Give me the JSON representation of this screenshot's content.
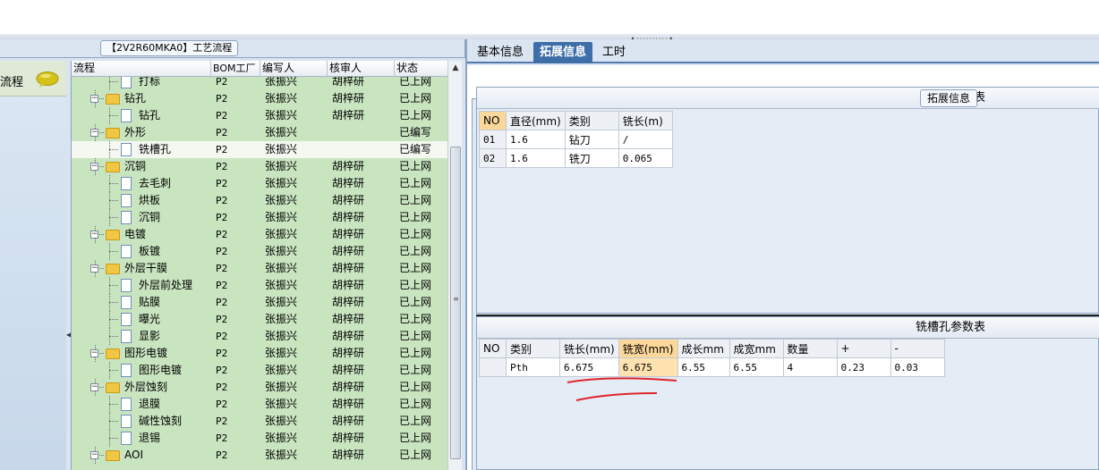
{
  "left_pane": {
    "legend": "【2V2R60MKA0】工艺流程",
    "flow_label": "流程",
    "tree_columns": [
      "流程",
      "BOM工厂",
      "编写人",
      "核审人",
      "状态"
    ],
    "rows": [
      {
        "level": 2,
        "type": "doc",
        "name": "打标",
        "bom": "P2",
        "writer": "张振兴",
        "reviewer": "胡梓研",
        "status": "已上网"
      },
      {
        "level": 1,
        "type": "folder",
        "name": "钻孔",
        "bom": "P2",
        "writer": "张振兴",
        "reviewer": "胡梓研",
        "status": "已上网"
      },
      {
        "level": 2,
        "type": "doc",
        "name": "钻孔",
        "bom": "P2",
        "writer": "张振兴",
        "reviewer": "胡梓研",
        "status": "已上网"
      },
      {
        "level": 1,
        "type": "folder",
        "name": "外形",
        "bom": "P2",
        "writer": "张振兴",
        "reviewer": "",
        "status": "已编写"
      },
      {
        "level": 2,
        "type": "doc",
        "name": "铣槽孔",
        "bom": "P2",
        "writer": "张振兴",
        "reviewer": "",
        "status": "已编写",
        "selected": true
      },
      {
        "level": 1,
        "type": "folder",
        "name": "沉铜",
        "bom": "P2",
        "writer": "张振兴",
        "reviewer": "胡梓研",
        "status": "已上网"
      },
      {
        "level": 2,
        "type": "doc",
        "name": "去毛刺",
        "bom": "P2",
        "writer": "张振兴",
        "reviewer": "胡梓研",
        "status": "已上网"
      },
      {
        "level": 2,
        "type": "doc",
        "name": "烘板",
        "bom": "P2",
        "writer": "张振兴",
        "reviewer": "胡梓研",
        "status": "已上网"
      },
      {
        "level": 2,
        "type": "doc",
        "name": "沉铜",
        "bom": "P2",
        "writer": "张振兴",
        "reviewer": "胡梓研",
        "status": "已上网"
      },
      {
        "level": 1,
        "type": "folder",
        "name": "电镀",
        "bom": "P2",
        "writer": "张振兴",
        "reviewer": "胡梓研",
        "status": "已上网"
      },
      {
        "level": 2,
        "type": "doc",
        "name": "板镀",
        "bom": "P2",
        "writer": "张振兴",
        "reviewer": "胡梓研",
        "status": "已上网"
      },
      {
        "level": 1,
        "type": "folder",
        "name": "外层干膜",
        "bom": "P2",
        "writer": "张振兴",
        "reviewer": "胡梓研",
        "status": "已上网"
      },
      {
        "level": 2,
        "type": "doc",
        "name": "外层前处理",
        "bom": "P2",
        "writer": "张振兴",
        "reviewer": "胡梓研",
        "status": "已上网"
      },
      {
        "level": 2,
        "type": "doc",
        "name": "贴膜",
        "bom": "P2",
        "writer": "张振兴",
        "reviewer": "胡梓研",
        "status": "已上网"
      },
      {
        "level": 2,
        "type": "doc",
        "name": "曝光",
        "bom": "P2",
        "writer": "张振兴",
        "reviewer": "胡梓研",
        "status": "已上网"
      },
      {
        "level": 2,
        "type": "doc",
        "name": "显影",
        "bom": "P2",
        "writer": "张振兴",
        "reviewer": "胡梓研",
        "status": "已上网"
      },
      {
        "level": 1,
        "type": "folder",
        "name": "图形电镀",
        "bom": "P2",
        "writer": "张振兴",
        "reviewer": "胡梓研",
        "status": "已上网"
      },
      {
        "level": 2,
        "type": "doc",
        "name": "图形电镀",
        "bom": "P2",
        "writer": "张振兴",
        "reviewer": "胡梓研",
        "status": "已上网"
      },
      {
        "level": 1,
        "type": "folder",
        "name": "外层蚀刻",
        "bom": "P2",
        "writer": "张振兴",
        "reviewer": "胡梓研",
        "status": "已上网"
      },
      {
        "level": 2,
        "type": "doc",
        "name": "退膜",
        "bom": "P2",
        "writer": "张振兴",
        "reviewer": "胡梓研",
        "status": "已上网"
      },
      {
        "level": 2,
        "type": "doc",
        "name": "碱性蚀刻",
        "bom": "P2",
        "writer": "张振兴",
        "reviewer": "胡梓研",
        "status": "已上网"
      },
      {
        "level": 2,
        "type": "doc",
        "name": "退锡",
        "bom": "P2",
        "writer": "张振兴",
        "reviewer": "胡梓研",
        "status": "已上网"
      },
      {
        "level": 1,
        "type": "folder",
        "name": "AOI",
        "bom": "P2",
        "writer": "张振兴",
        "reviewer": "胡梓研",
        "status": "已上网"
      }
    ]
  },
  "right_pane": {
    "tabs": [
      {
        "label": "基本信息",
        "active": false
      },
      {
        "label": "拓展信息",
        "active": true
      },
      {
        "label": "工时",
        "active": false
      }
    ],
    "legend": "拓展信息",
    "tool_table": {
      "title": "刀径表",
      "headers": [
        "NO",
        "直径(mm)",
        "类别",
        "铣长(m)"
      ],
      "rows": [
        [
          "01",
          "1.6",
          "钻刀",
          "/"
        ],
        [
          "02",
          "1.6",
          "铣刀",
          "0.065"
        ]
      ]
    },
    "slot_table": {
      "title": "铣槽孔参数表",
      "headers": [
        "NO",
        "类别",
        "铣长(mm)",
        "铣宽(mm)",
        "成长mm",
        "成宽mm",
        "数量",
        "+",
        "-"
      ],
      "rows": [
        [
          "",
          "Pth",
          "6.675",
          "6.675",
          "6.55",
          "6.55",
          "4",
          "0.23",
          "0.03"
        ]
      ]
    }
  },
  "colors": {
    "tree_bg": "#c9e5c0",
    "tab_active": "#3d6ea8",
    "highlight": "#fbd79a",
    "annotation": "#e0242b"
  }
}
